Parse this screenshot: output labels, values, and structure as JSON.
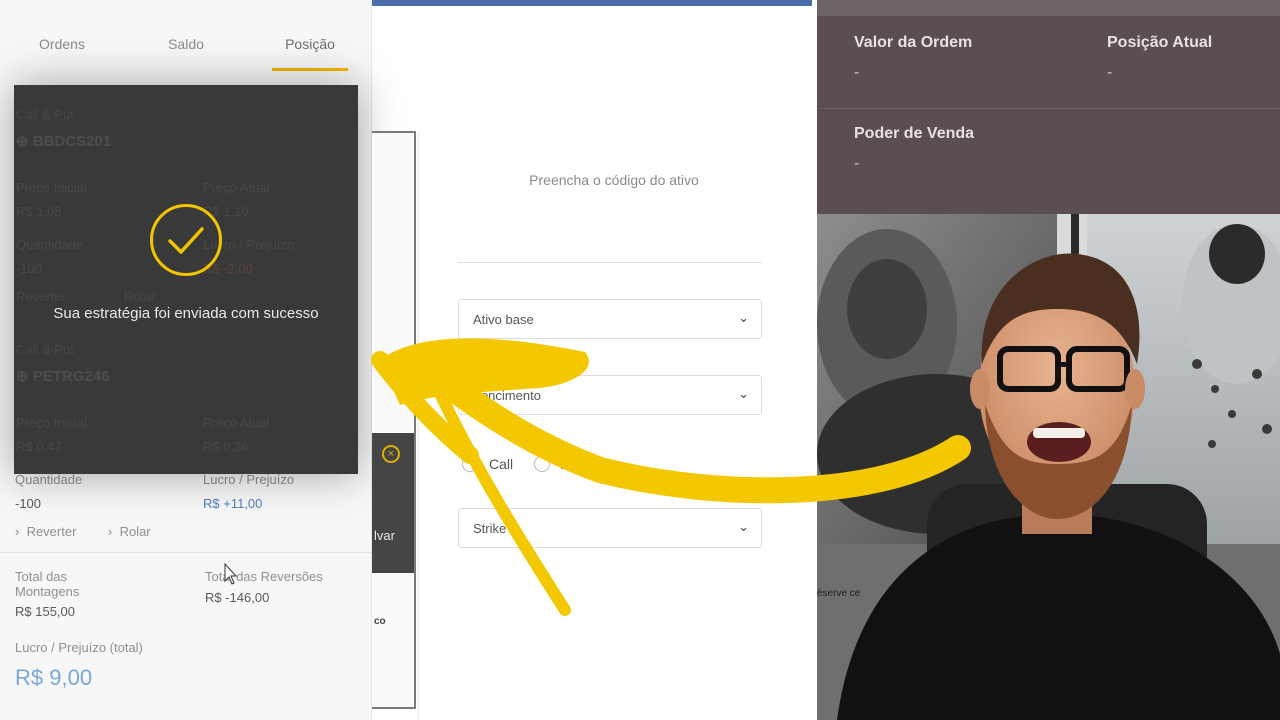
{
  "tabs": [
    "Ordens",
    "Saldo",
    "Posição"
  ],
  "positions": [
    {
      "type": "Call & Put",
      "code": "BBDCS201",
      "preco_inicial_label": "Preço Inicial",
      "preco_inicial": "R$ 1,08",
      "preco_atual_label": "Preço Atual",
      "preco_atual": "R$ 1,10",
      "quantidade_label": "Quantidade",
      "quantidade": "-100",
      "lucro_label": "Lucro / Prejuízo",
      "lucro": "R$ -2,00",
      "reverter": "Reverter",
      "rolar": "Rolar"
    },
    {
      "type": "Call & Put",
      "code": "PETRG246",
      "preco_inicial_label": "Preço Inicial",
      "preco_inicial": "R$ 0,47",
      "preco_atual_label": "Preço Atual",
      "preco_atual": "R$ 0,36",
      "quantidade_label": "Quantidade",
      "quantidade": "-100",
      "lucro_label": "Lucro / Prejuízo",
      "lucro": "R$ +11,00",
      "reverter": "Reverter",
      "rolar": "Rolar"
    }
  ],
  "totals": {
    "montagens_label_1": "Total das",
    "montagens_label_2": "Montagens",
    "montagens_value": "R$ 155,00",
    "reversoes_label": "Total das Reversões",
    "reversoes_value": "R$ -146,00",
    "lucro_total_label": "Lucro / Prejuízo (total)",
    "lucro_total_value": "R$ 9,00"
  },
  "overlay": {
    "message": "Sua estratégia foi enviada com sucesso"
  },
  "middle": {
    "close_symbol": "×",
    "save_label_partial": "lvar",
    "tiny_text": "co"
  },
  "form": {
    "hint": "Preencha o código do ativo",
    "select_ativo_base": "Ativo base",
    "select_vencimento": "Vencimento",
    "radio_call": "Call",
    "radio_put": "Put",
    "select_strike": "Strike",
    "chevron": "⌄"
  },
  "right_panel": {
    "valor_ordem_label": "Valor da Ordem",
    "valor_ordem_value": "-",
    "posicao_atual_label": "Posição Atual",
    "posicao_atual_value": "-",
    "poder_venda_label": "Poder de Venda",
    "poder_venda_value": "-"
  },
  "video": {
    "caption_fragment": "éserve ce"
  },
  "colors": {
    "accent_yellow": "#f2c500",
    "topbar_blue": "#4b6ea8",
    "profit_blue": "#4f7fbf",
    "loss_red": "#d9534f",
    "right_panel_bg": "#5b4e50"
  }
}
